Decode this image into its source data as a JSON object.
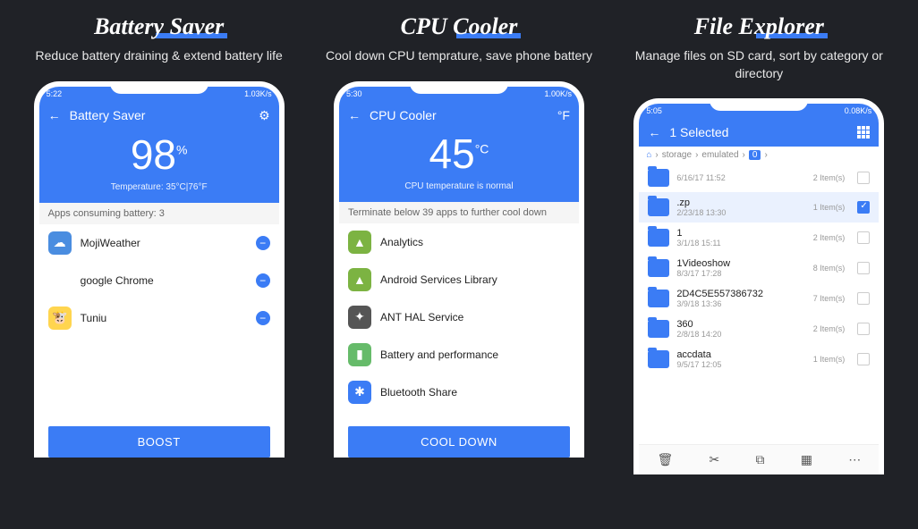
{
  "panels": [
    {
      "title": "Battery Saver",
      "subtitle": "Reduce battery draining & extend battery life",
      "status_time": "5:22",
      "status_right": "1.03K/s",
      "screen_title": "Battery Saver",
      "big_value": "98",
      "big_unit": "%",
      "subhero": "Temperature: 35°C|76°F",
      "section_label": "Apps consuming battery: 3",
      "apps": [
        {
          "name": "MojiWeather",
          "bg": "#4a8de0",
          "glyph": "☁"
        },
        {
          "name": "google Chrome",
          "bg": "#fff",
          "glyph": "◉"
        },
        {
          "name": "Tuniu",
          "bg": "#ffd54f",
          "glyph": "🐮"
        }
      ],
      "cta": "BOOST"
    },
    {
      "title": "CPU Cooler",
      "subtitle": "Cool down CPU temprature, save phone battery",
      "status_time": "5:30",
      "status_right": "1.00K/s",
      "screen_title": "CPU Cooler",
      "right_unit": "°F",
      "big_value": "45",
      "big_unit": "°C",
      "subhero": "CPU temperature is normal",
      "section_label": "Terminate below 39 apps to further cool down",
      "apps": [
        {
          "name": "Analytics",
          "bg": "#7cb342",
          "glyph": "▲"
        },
        {
          "name": "Android Services Library",
          "bg": "#7cb342",
          "glyph": "▲"
        },
        {
          "name": "ANT HAL Service",
          "bg": "#555",
          "glyph": "✦"
        },
        {
          "name": "Battery and performance",
          "bg": "#66bb6a",
          "glyph": "▮"
        },
        {
          "name": "Bluetooth Share",
          "bg": "#3b7cf5",
          "glyph": "✱"
        }
      ],
      "cta": "COOL DOWN"
    },
    {
      "title": "File Explorer",
      "subtitle": "Manage files on SD card, sort by category or directory",
      "status_time": "5:05",
      "status_right": "0.08K/s",
      "screen_title": "1 Selected",
      "crumbs": [
        "storage",
        "emulated",
        "0"
      ],
      "files": [
        {
          "name": "",
          "date": "6/16/17 11:52",
          "count": "2 Item(s)",
          "selected": false,
          "partial": true
        },
        {
          "name": ".zp",
          "date": "2/23/18 13:30",
          "count": "1 Item(s)",
          "selected": true
        },
        {
          "name": "1",
          "date": "3/1/18 15:11",
          "count": "2 Item(s)",
          "selected": false
        },
        {
          "name": "1Videoshow",
          "date": "8/3/17 17:28",
          "count": "8 Item(s)",
          "selected": false
        },
        {
          "name": "2D4C5E557386732",
          "date": "3/9/18 13:36",
          "count": "7 Item(s)",
          "selected": false
        },
        {
          "name": "360",
          "date": "2/8/18 14:20",
          "count": "2 Item(s)",
          "selected": false
        },
        {
          "name": "accdata",
          "date": "9/5/17 12:05",
          "count": "1 Item(s)",
          "selected": false
        }
      ],
      "toolbar_icons": [
        "🗑",
        "✂",
        "⧉",
        "▦",
        "⋯"
      ]
    }
  ]
}
